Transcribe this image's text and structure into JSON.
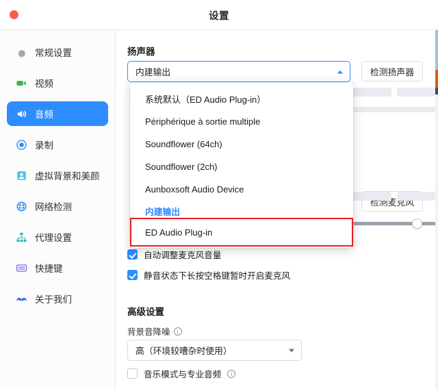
{
  "window": {
    "title": "设置",
    "close_button": "close-button"
  },
  "sidebar": {
    "items": [
      {
        "label": "常规设置",
        "icon": "gear-icon",
        "color": "#9aa0a8",
        "active": false
      },
      {
        "label": "视频",
        "icon": "video-icon",
        "color": "#3cb54a",
        "active": false
      },
      {
        "label": "音频",
        "icon": "speaker-icon",
        "color": "#ffffff",
        "active": true
      },
      {
        "label": "录制",
        "icon": "record-icon",
        "color": "#2d8cff",
        "active": false
      },
      {
        "label": "虚拟背景和美颜",
        "icon": "person-icon",
        "color": "#4ecbe0",
        "active": false
      },
      {
        "label": "网络检测",
        "icon": "globe-icon",
        "color": "#2d8cff",
        "active": false
      },
      {
        "label": "代理设置",
        "icon": "sitemap-icon",
        "color": "#35b8c9",
        "active": false
      },
      {
        "label": "快捷键",
        "icon": "keyboard-icon",
        "color": "#7c6ef0",
        "active": false
      },
      {
        "label": "关于我们",
        "icon": "about-icon",
        "color": "#2d6df6",
        "active": false
      }
    ]
  },
  "main": {
    "speaker": {
      "section_title": "扬声器",
      "selected_device": "内建输出",
      "test_button": "检测扬声器"
    },
    "microphone": {
      "test_button": "检测麦克风"
    },
    "checkboxes": [
      {
        "label": "自动调整麦克风音量",
        "checked": true
      },
      {
        "label": "静音状态下长按空格键暂时开启麦克风",
        "checked": true
      }
    ],
    "advanced": {
      "section_title": "高级设置",
      "noise_label": "背景音降噪",
      "noise_info_icon": "info-icon",
      "noise_value": "高（环境较嘈杂时使用）",
      "music_mode": {
        "label": "音乐模式与专业音频",
        "checked": false,
        "info_icon": "info-icon"
      }
    },
    "volume_slider": {
      "value": 100
    }
  },
  "dropdown": {
    "open": true,
    "items": [
      {
        "label": "系统默认（ED Audio Plug-in）",
        "type": "option",
        "highlighted": false
      },
      {
        "label": "Périphérique à sortie multiple",
        "type": "option",
        "highlighted": false
      },
      {
        "label": "Soundflower (64ch)",
        "type": "option",
        "highlighted": false
      },
      {
        "label": "Soundflower (2ch)",
        "type": "option",
        "highlighted": false
      },
      {
        "label": "Aunboxsoft Audio Device",
        "type": "option",
        "highlighted": false
      },
      {
        "label": "内建输出",
        "type": "group",
        "highlighted": false
      },
      {
        "label": "ED Audio Plug-in",
        "type": "option",
        "highlighted": true
      }
    ]
  },
  "annotation": {
    "highlight_color": "#ee1c22"
  },
  "colors": {
    "accent": "#2d8cff",
    "close": "#fb5b53",
    "text": "#1d1d1d"
  }
}
